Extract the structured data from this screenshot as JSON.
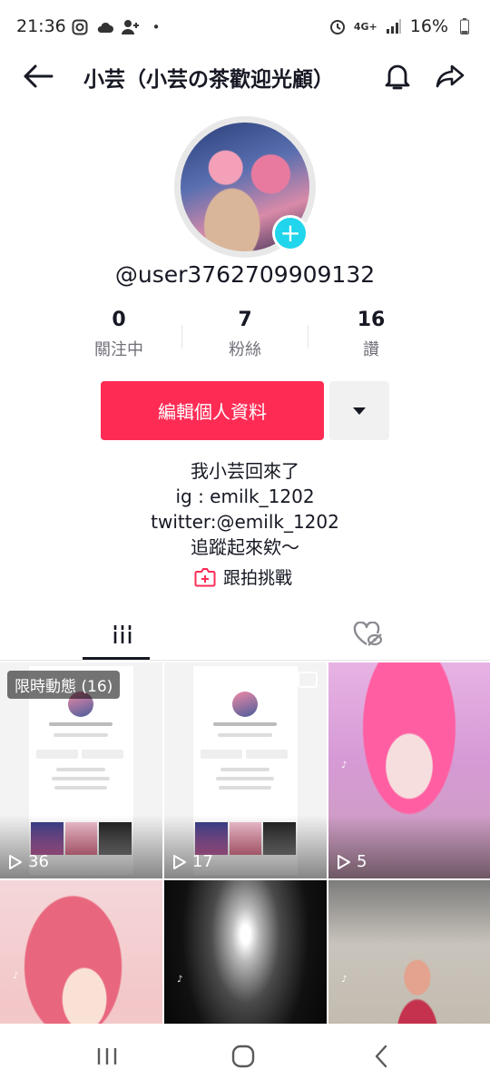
{
  "status_bar": {
    "time": "21:36",
    "dot": "•",
    "network": "4G+",
    "battery": "16%"
  },
  "header": {
    "title": "小芸（小芸の茶歡迎光顧）"
  },
  "profile": {
    "username": "@user3762709909132",
    "stats": [
      {
        "num": "0",
        "label": "關注中"
      },
      {
        "num": "7",
        "label": "粉絲"
      },
      {
        "num": "16",
        "label": "讚"
      }
    ],
    "edit_button": "編輯個人資料",
    "bio": [
      "我小芸回來了",
      "ig : emilk_1202",
      "twitter:@emilk_1202",
      "追蹤起來欸～"
    ],
    "duet_label": "跟拍挑戰"
  },
  "grid": {
    "story_badge": "限時動態 (16)",
    "tiles": [
      {
        "plays": "36",
        "kind": "screenshot"
      },
      {
        "plays": "17",
        "kind": "screenshot"
      },
      {
        "plays": "5",
        "kind": "pink"
      },
      {
        "plays": "",
        "kind": "anime"
      },
      {
        "plays": "",
        "kind": "dark"
      },
      {
        "plays": "",
        "kind": "room"
      }
    ]
  },
  "colors": {
    "accent": "#fe2c55",
    "add_badge": "#20d5ec",
    "text": "#161823",
    "muted": "#6f7078"
  }
}
